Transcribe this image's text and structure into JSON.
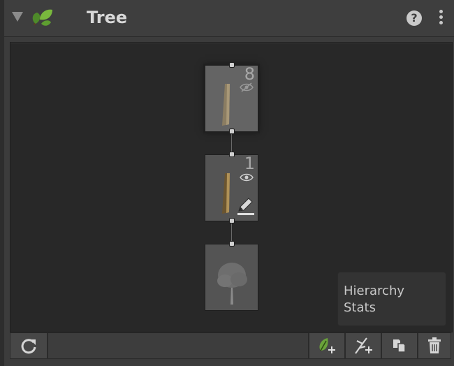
{
  "header": {
    "title": "Tree",
    "help_label": "?"
  },
  "nodes": [
    {
      "kind": "trunk",
      "count": "8",
      "visibility": "hidden-eye-icon",
      "selected": true
    },
    {
      "kind": "trunk",
      "count": "1",
      "visibility": "eye-icon",
      "editing": true,
      "selected": false
    },
    {
      "kind": "tree-preview",
      "count": "",
      "selected": false
    }
  ],
  "stats_panel": {
    "line1": "Hierarchy",
    "line2": "Stats"
  },
  "toolbar": {
    "buttons": [
      "refresh-icon",
      "add-leaf-icon",
      "add-branch-icon",
      "duplicate-icon",
      "trash-icon"
    ]
  },
  "colors": {
    "background": "#282828",
    "node": "#545454",
    "leaf_green": "#6aa23a"
  }
}
